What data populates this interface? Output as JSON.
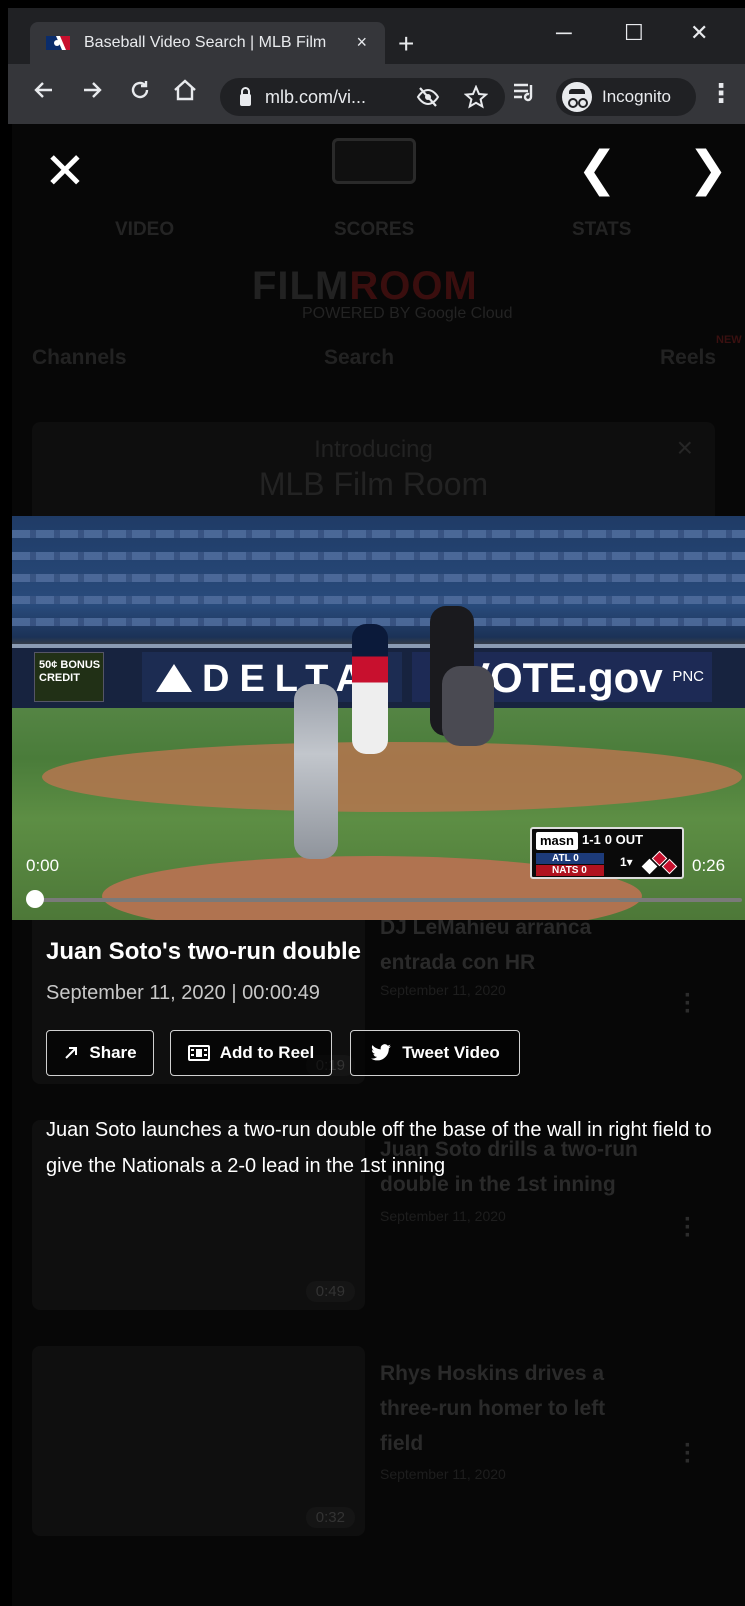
{
  "browser": {
    "tab_title": "Baseball Video Search | MLB Film",
    "tab_close": "×",
    "new_tab": "+",
    "window_controls": {
      "minimize": "─",
      "maximize": "☐",
      "close": "✕"
    },
    "url": "mlb.com/vi...",
    "profile_label": "Incognito",
    "menu": "⋮",
    "icons": [
      "back-arrow-icon",
      "forward-arrow-icon",
      "reload-icon",
      "home-icon",
      "lock-icon",
      "eye-off-icon",
      "star-icon",
      "reading-list-icon",
      "incognito-icon",
      "kebab-menu-icon"
    ]
  },
  "background_page": {
    "nav": [
      "VIDEO",
      "SCORES",
      "STATS"
    ],
    "film_logo": {
      "left": "FILM",
      "right": "ROOM"
    },
    "powered": "POWERED BY Google Cloud",
    "tools": {
      "channels": "Channels",
      "search": "Search",
      "reels": "Reels",
      "new_badge": "NEW"
    },
    "banner": {
      "line1": "Introducing",
      "line2": "MLB Film Room",
      "close": "×"
    },
    "cards": [
      {
        "title": "DJ LeMahieu arranca entrada con HR",
        "date": "September 11, 2020",
        "duration": "0:19"
      },
      {
        "title": "Juan Soto drills a two-run double in the 1st inning",
        "date": "September 11, 2020",
        "duration": "0:49"
      },
      {
        "title": "Rhys Hoskins drives a three-run homer to left field",
        "date": "September 11, 2020",
        "duration": "0:32"
      }
    ]
  },
  "overlay": {
    "close": "✕",
    "prev": "❮",
    "next": "❯"
  },
  "video": {
    "current_time": "0:00",
    "total_time": "0:26",
    "progress": 0,
    "scene_text": {
      "delta": "DELTA",
      "vote": "VOTE.gov",
      "pnc": "PNC",
      "bonus": "50¢ BONUS CREDIT",
      "scorebug": {
        "network": "masn",
        "count": "1-1",
        "outs": "0 OUT",
        "away": "ATL",
        "away_score": "0",
        "home": "NATS",
        "home_score": "0",
        "inning": "1▾"
      }
    }
  },
  "info": {
    "title": "Juan Soto's two-run double",
    "meta": "September 11, 2020 | 00:00:49",
    "buttons": {
      "share": "Share",
      "add_to_reel": "Add to Reel",
      "tweet": "Tweet Video"
    },
    "description": "Juan Soto launches a two-run double off the base of the wall in right field to give the Nationals a 2-0 lead in the 1st inning"
  }
}
